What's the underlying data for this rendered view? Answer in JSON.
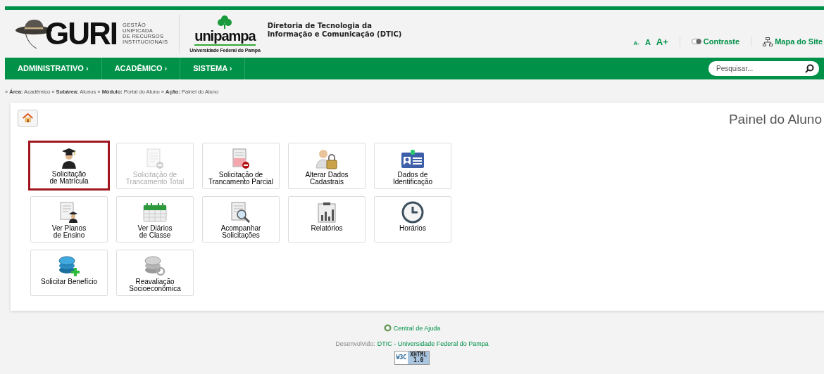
{
  "header": {
    "logo_text": "GURI",
    "logo_caption": "GESTÃO\nUNIFICADA\nDE RECURSOS\nINSTITUCIONAIS",
    "partner_name": "unipampa",
    "partner_caption": "Universidade Federal do Pampa",
    "department": "Diretoria de Tecnologia da\nInformação e Comunicação (DTIC)",
    "font_sizes": [
      "A-",
      "A",
      "A+"
    ],
    "contrast": "Contraste",
    "sitemap": "Mapa do Site"
  },
  "nav": {
    "items": [
      {
        "label": "ADMINISTRATIVO ›"
      },
      {
        "label": "ACADÊMICO ›"
      },
      {
        "label": "SISTEMA ›"
      }
    ],
    "search": {
      "placeholder": "Pesquisar..."
    }
  },
  "breadcrumb": "» **Área:** Acadêmico » **Subárea:** Alunos » **Módulo:** Portal do Aluno » **Ação:** Painel do Aluno",
  "panel": {
    "title": "Painel do Aluno",
    "tiles": [
      {
        "label": "Solicitação\nde Matrícula",
        "selected": true,
        "disabled": false
      },
      {
        "label": "Solicitação de\nTrancamento Total",
        "selected": false,
        "disabled": true
      },
      {
        "label": "Solicitação de\nTrancamento Parcial",
        "selected": false,
        "disabled": false
      },
      {
        "label": "Alterar Dados\nCadastrais",
        "selected": false,
        "disabled": false
      },
      {
        "label": "Dados de\nIdentificação",
        "selected": false,
        "disabled": false
      },
      {
        "label": "Ver Planos\nde Ensino",
        "selected": false,
        "disabled": false
      },
      {
        "label": "Ver Diários\nde Classe",
        "selected": false,
        "disabled": false
      },
      {
        "label": "Acompanhar\nSolicitações",
        "selected": false,
        "disabled": false
      },
      {
        "label": "Relatórios",
        "selected": false,
        "disabled": false
      },
      {
        "label": "Horários",
        "selected": false,
        "disabled": false
      },
      {
        "label": "Solicitar Benefício",
        "selected": false,
        "disabled": false
      },
      {
        "label": "Reavaliação\nSocioeconômica",
        "selected": false,
        "disabled": false
      }
    ]
  },
  "footer": {
    "help": "Central de Ajuda",
    "developed_label": "Desenvolvido:",
    "developed_link": "DTIC - Universidade Federal do Pampa",
    "badge_left": "W3C",
    "badge_right": "XHTML\n1.0"
  }
}
